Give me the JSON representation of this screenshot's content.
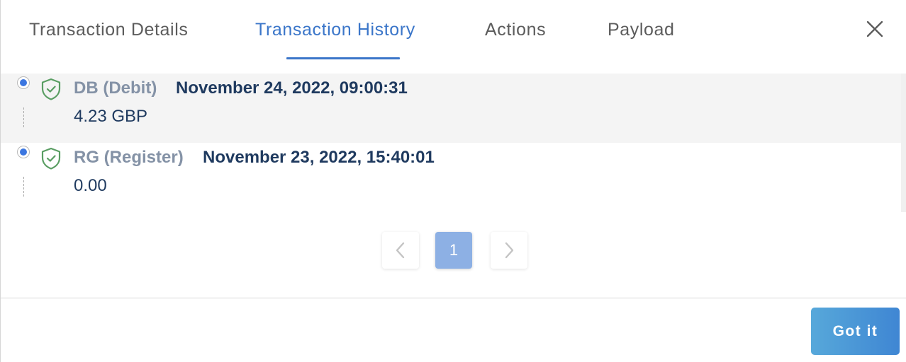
{
  "tabs": [
    {
      "label": "Transaction Details",
      "active": false
    },
    {
      "label": "Transaction History",
      "active": true
    },
    {
      "label": "Actions",
      "active": false
    },
    {
      "label": "Payload",
      "active": false
    }
  ],
  "close_icon": "close-icon",
  "history": [
    {
      "status_icon": "shield-check-icon",
      "type": "DB (Debit)",
      "timestamp": "November 24, 2022, 09:00:31",
      "amount": "4.23 GBP",
      "selected": true
    },
    {
      "status_icon": "shield-check-icon",
      "type": "RG (Register)",
      "timestamp": "November 23, 2022, 15:40:01",
      "amount": "0.00",
      "selected": true
    }
  ],
  "pagination": {
    "prev_icon": "chevron-left-icon",
    "current_page": "1",
    "next_icon": "chevron-right-icon"
  },
  "footer": {
    "got_it_label": "Got it"
  },
  "colors": {
    "accent": "#3b76c9",
    "shield": "#5a9e63",
    "button": "#4a95d6"
  }
}
